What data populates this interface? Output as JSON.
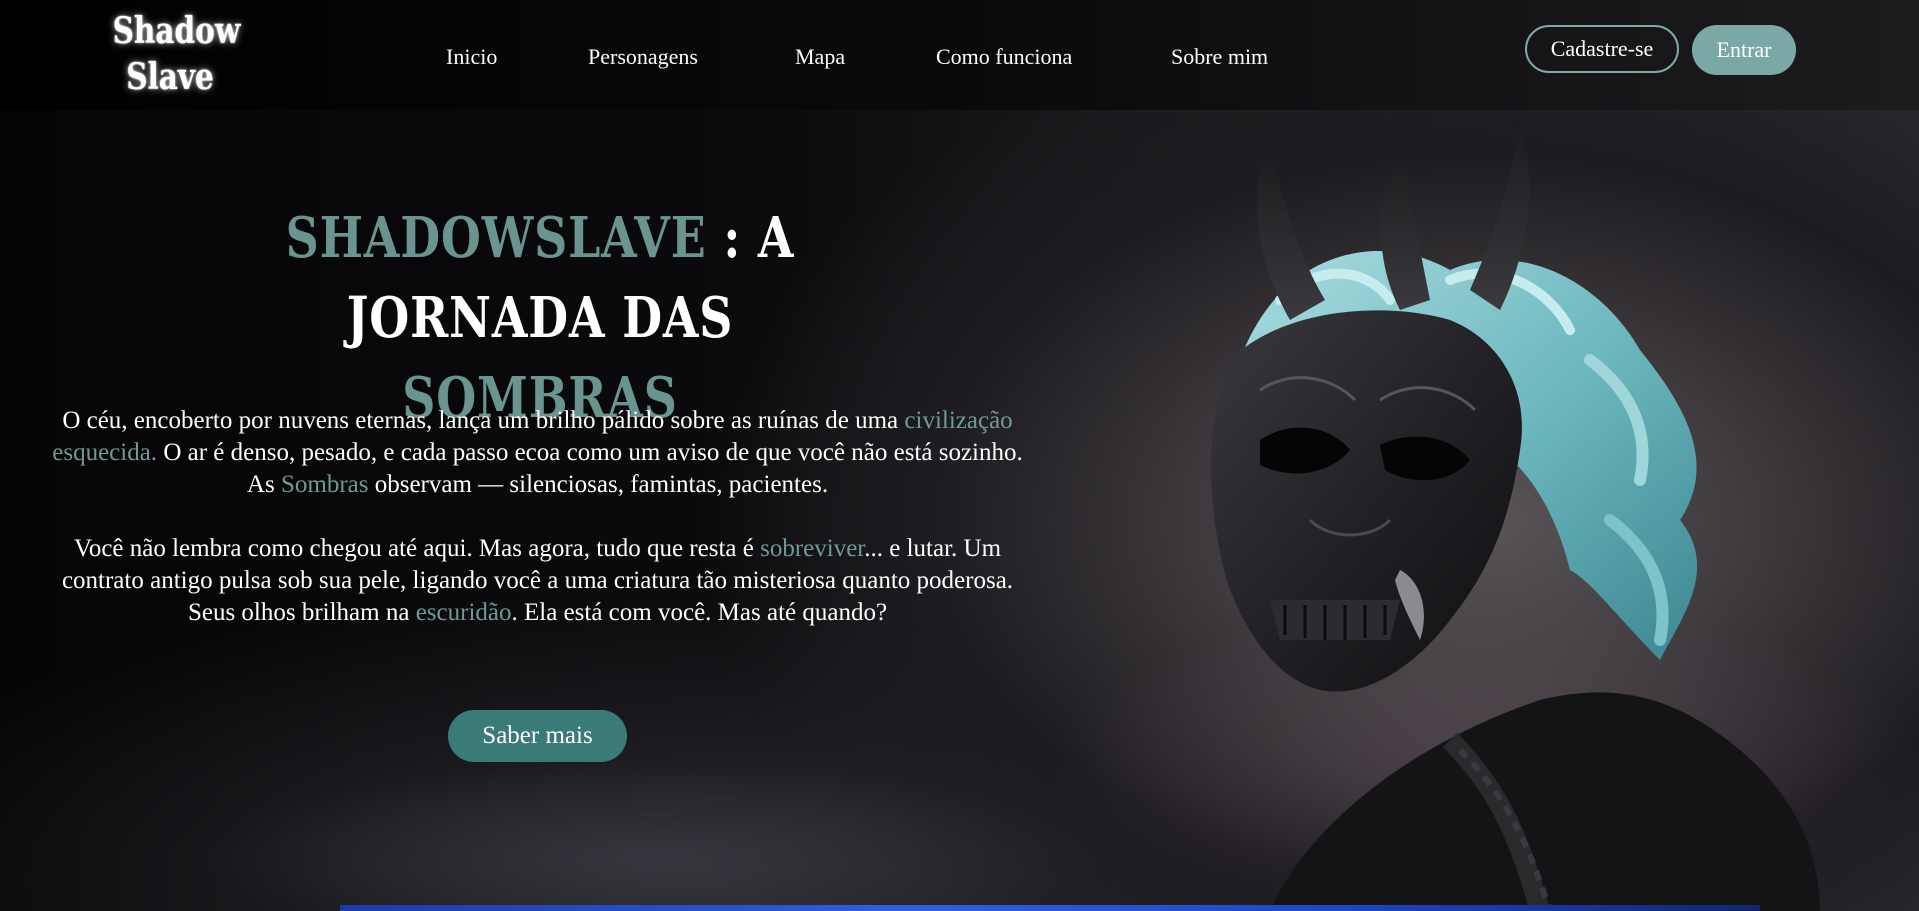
{
  "header": {
    "logo_line1": "Shadow",
    "logo_line2": "Slave",
    "nav": [
      "Inicio",
      "Personagens",
      "Mapa",
      "Como funciona",
      "Sobre mim"
    ],
    "signup_label": "Cadastre-se",
    "login_label": "Entrar"
  },
  "hero": {
    "title_accent": "SHADOWSLAVE",
    "title_mid": " : A JORNADA DAS",
    "title_end": "SOMBRAS",
    "p1": {
      "a": "O céu, encoberto por nuvens eternas, lança um brilho pálido sobre as ruínas de uma ",
      "h1": "civilização esquecida.",
      "b": " O ar é denso, pesado, e cada passo ecoa como um aviso de que você não está sozinho. As ",
      "h2": "Sombras",
      "c": " observam — silenciosas, famintas, pacientes."
    },
    "p2": {
      "a": "Você não lembra como chegou até aqui. Mas agora, tudo que resta é ",
      "h1": "sobreviver",
      "b": "... e lutar. Um contrato antigo pulsa sob sua pele, ligando você a uma criatura tão misteriosa quanto poderosa. Seus olhos brilham na ",
      "h2": "escuridão",
      "c": ". Ela está com você. Mas até quando?"
    },
    "cta_label": "Saber mais"
  },
  "colors": {
    "accent": "#6a9490",
    "button_fill": "#7aa8a5",
    "cta": "#3a7b78",
    "background": "#050506"
  }
}
